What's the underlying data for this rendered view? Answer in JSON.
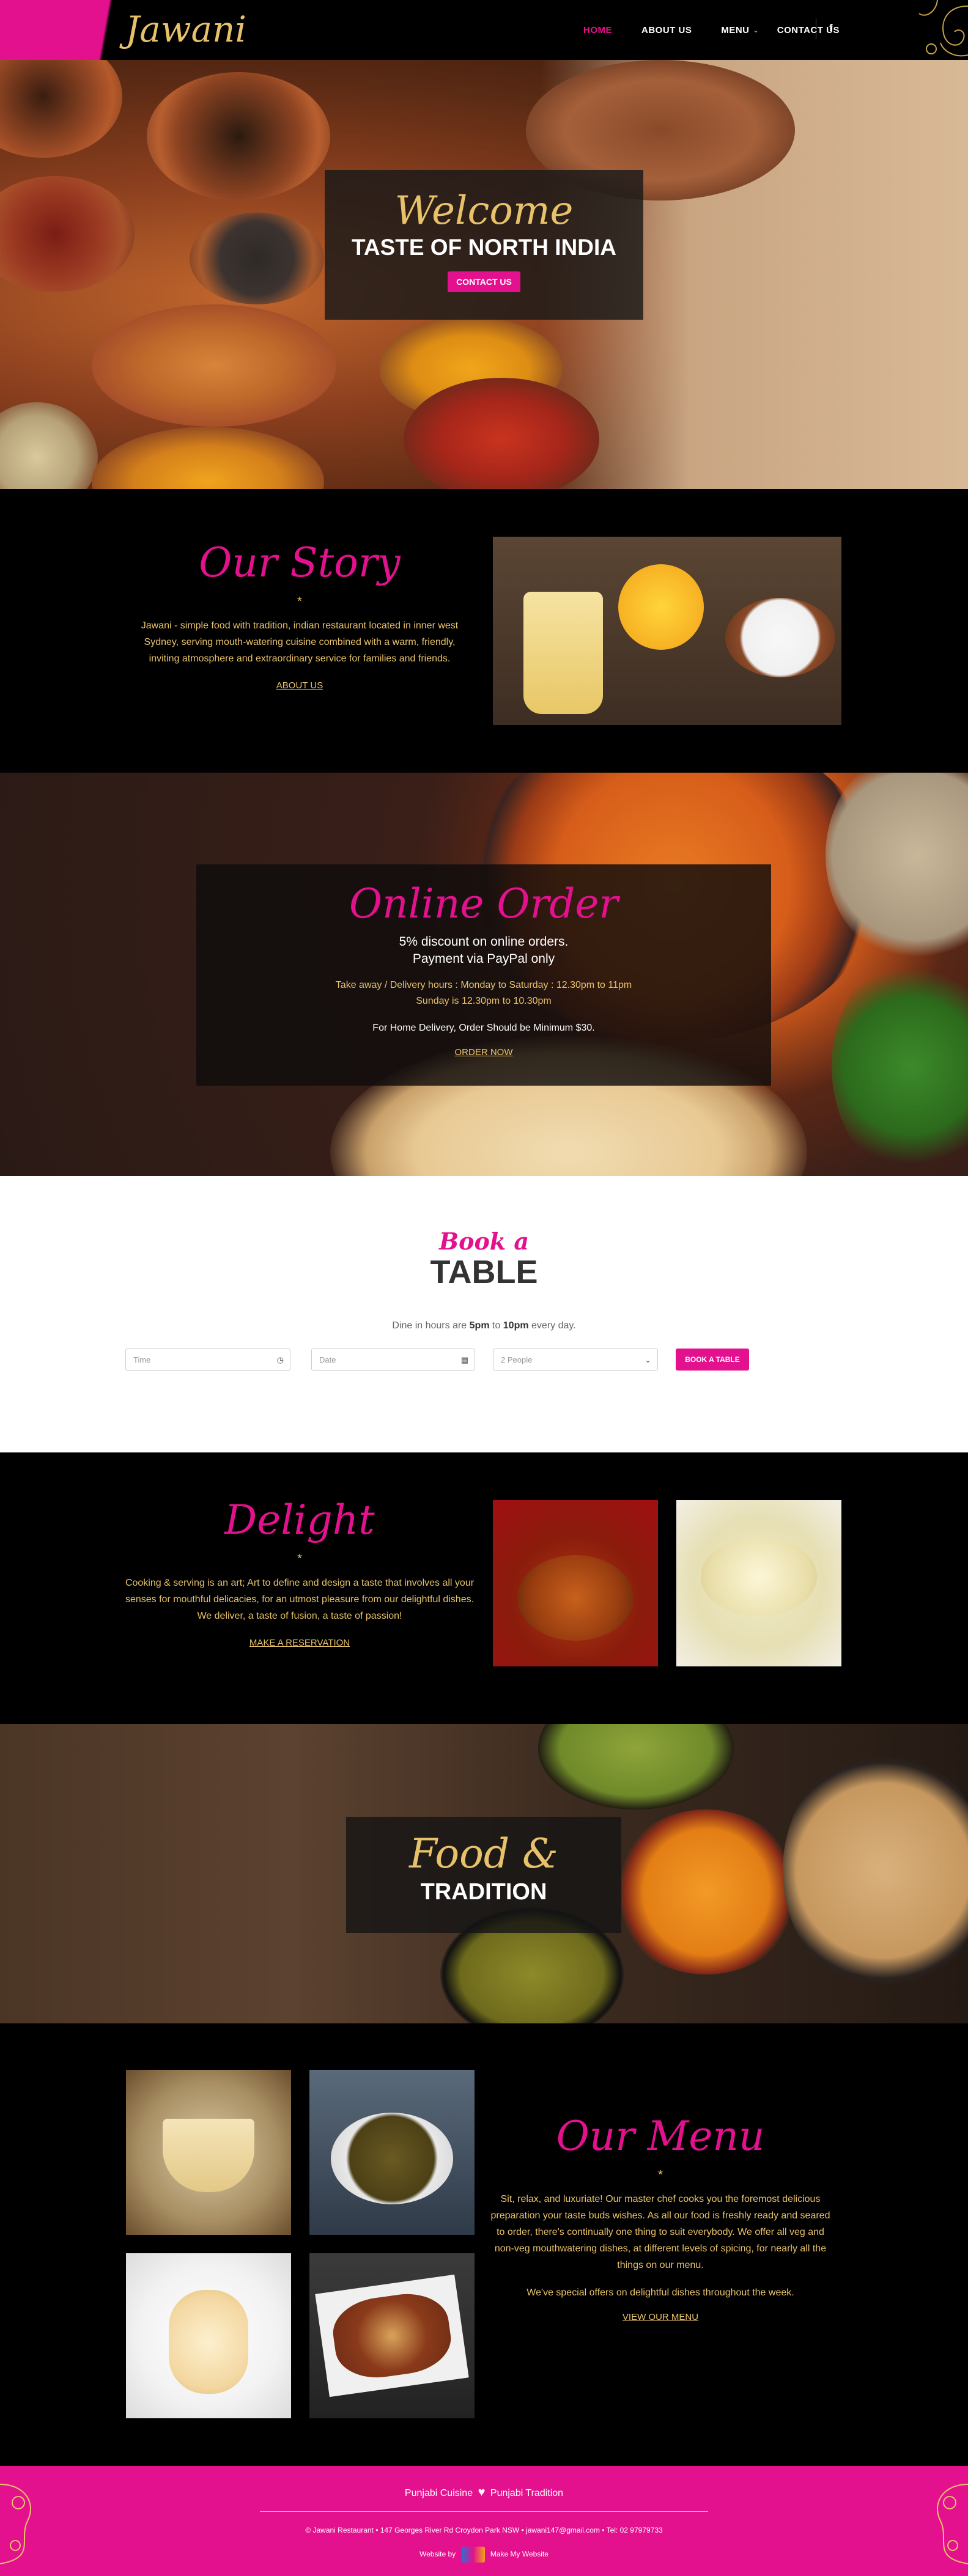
{
  "header": {
    "logo": "Jawani",
    "nav": [
      {
        "label": "HOME",
        "active": true
      },
      {
        "label": "ABOUT US",
        "active": false
      },
      {
        "label": "MENU",
        "active": false
      },
      {
        "label": "CONTACT US",
        "active": false
      }
    ],
    "facebook": "f"
  },
  "hero": {
    "welcome": "Welcome",
    "title": "TASTE OF NORTH INDIA",
    "button": "CONTACT US"
  },
  "story": {
    "title": "Our Story",
    "star": "*",
    "text": "Jawani - simple food with tradition, indian restaurant located in inner west Sydney, serving mouth-watering cuisine combined with a warm, friendly, inviting atmosphere and extraordinary service for families and friends.",
    "link": "ABOUT US"
  },
  "order": {
    "title": "Online Order",
    "line1": "5% discount on online orders.",
    "line2": "Payment via PayPal only",
    "hours1": "Take away / Delivery hours : Monday to Saturday : 12.30pm to 11pm",
    "hours2": "Sunday is 12.30pm to 10.30pm",
    "note": "For Home Delivery, Order Should be Minimum $30.",
    "link": "ORDER NOW"
  },
  "book": {
    "script": "Book a",
    "title": "TABLE",
    "text_pre": "Dine in hours are ",
    "from": "5pm",
    "to_word": " to ",
    "to": "10pm",
    "text_post": " every day.",
    "time_placeholder": "Time",
    "date_placeholder": "Date",
    "people": "2 People",
    "button": "BOOK A TABLE"
  },
  "delight": {
    "title": "Delight",
    "star": "*",
    "text": "Cooking & serving is an art; Art to define and design a taste that involves all your senses for mouthful delicacies, for an utmost pleasure from our delightful dishes. We deliver, a taste of fusion, a taste of passion!",
    "link": "MAKE A RESERVATION"
  },
  "tradition": {
    "script": "Food &",
    "title": "TRADITION"
  },
  "menu": {
    "title": "Our Menu",
    "star": "*",
    "text": "Sit, relax, and luxuriate! Our master chef cooks you the foremost delicious preparation your taste buds wishes. As all our food is freshly ready and seared to order, there's continually one thing to suit everybody. We offer all veg and non-veg mouthwatering dishes, at different levels of spicing, for nearly all the things on our menu.",
    "text2": "We've special offers on delightful dishes throughout the week.",
    "link": "VIEW OUR MENU"
  },
  "footer": {
    "tag_left": "Punjabi Cuisine",
    "tag_right": "Punjabi Tradition",
    "address": "© Jawani Restaurant • 147 Georges River Rd Croydon Park NSW • jawani147@gmail.com • Tel: 02 97979733",
    "credit_pre": "Website by",
    "credit": "Make My Website"
  },
  "colors": {
    "accent": "#e4118e",
    "gold": "#e8c26a",
    "black": "#000000"
  }
}
